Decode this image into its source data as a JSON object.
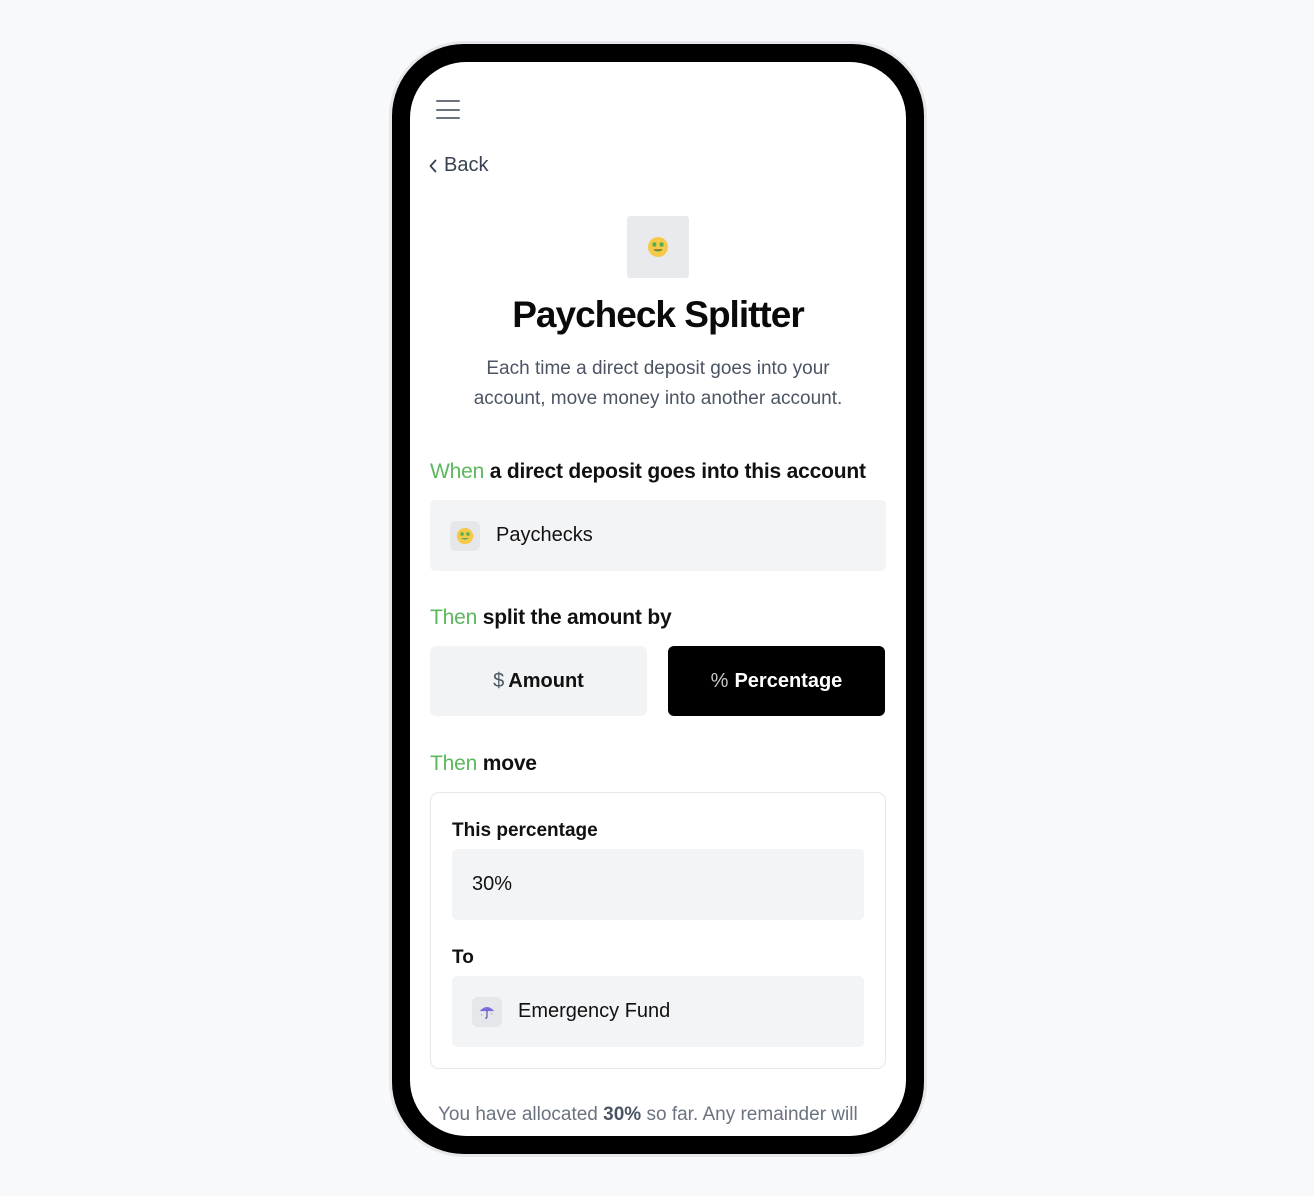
{
  "nav": {
    "back_label": "Back"
  },
  "header": {
    "title": "Paycheck Splitter",
    "description": "Each time a direct deposit goes into your account, move money into another account."
  },
  "when_section": {
    "keyword": "When",
    "text": "a direct deposit goes into this account",
    "account": {
      "name": "Paychecks",
      "icon": "money-mouth-face-icon"
    }
  },
  "split_section": {
    "keyword": "Then",
    "text": "split the amount by",
    "options": [
      {
        "symbol": "$",
        "label": "Amount",
        "selected": false
      },
      {
        "symbol": "%",
        "label": "Percentage",
        "selected": true
      }
    ]
  },
  "move_section": {
    "keyword": "Then",
    "text": "move",
    "percentage_label": "This percentage",
    "percentage_value": "30%",
    "to_label": "To",
    "to_account": {
      "name": "Emergency Fund",
      "icon": "umbrella-icon"
    }
  },
  "footer": {
    "prefix": "You have allocated",
    "amount": "30%",
    "suffix": "so far. Any remainder will"
  },
  "colors": {
    "accent_green": "#5cb85c",
    "selected_bg": "#000000",
    "field_bg": "#f3f4f6"
  }
}
